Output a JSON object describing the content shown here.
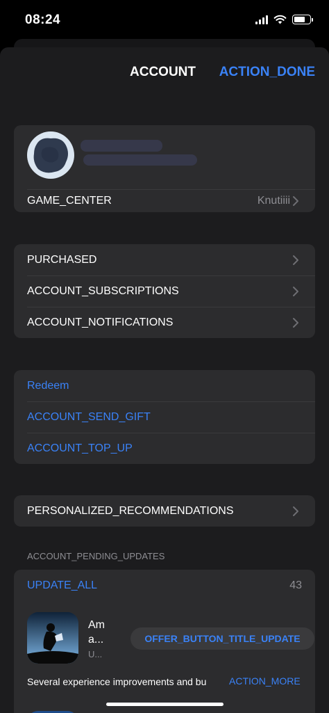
{
  "status_bar": {
    "time": "08:24"
  },
  "nav": {
    "title": "ACCOUNT",
    "done": "ACTION_DONE"
  },
  "profile": {
    "game_center_label": "GAME_CENTER",
    "game_center_value": "Knutiiii"
  },
  "purchases_group": [
    {
      "label": "PURCHASED"
    },
    {
      "label": "ACCOUNT_SUBSCRIPTIONS"
    },
    {
      "label": "ACCOUNT_NOTIFICATIONS"
    }
  ],
  "links_group": [
    {
      "label": "Redeem"
    },
    {
      "label": "ACCOUNT_SEND_GIFT"
    },
    {
      "label": "ACCOUNT_TOP_UP"
    }
  ],
  "recommendations": {
    "label": "PERSONALIZED_RECOMMENDATIONS"
  },
  "pending_updates": {
    "header": "ACCOUNT_PENDING_UPDATES",
    "update_all": "UPDATE_ALL",
    "count": "43",
    "app": {
      "name_line1": "Am",
      "name_line2": "a...",
      "subtitle": "U...",
      "button": "OFFER_BUTTON_TITLE_UPDATE",
      "notes": "Several experience improvements and bu",
      "more": "ACTION_MORE"
    }
  },
  "colors": {
    "accent": "#3a82f7",
    "sheet": "#1c1c1e",
    "cell": "#2c2c2e",
    "secondary_text": "#8e8e93"
  }
}
